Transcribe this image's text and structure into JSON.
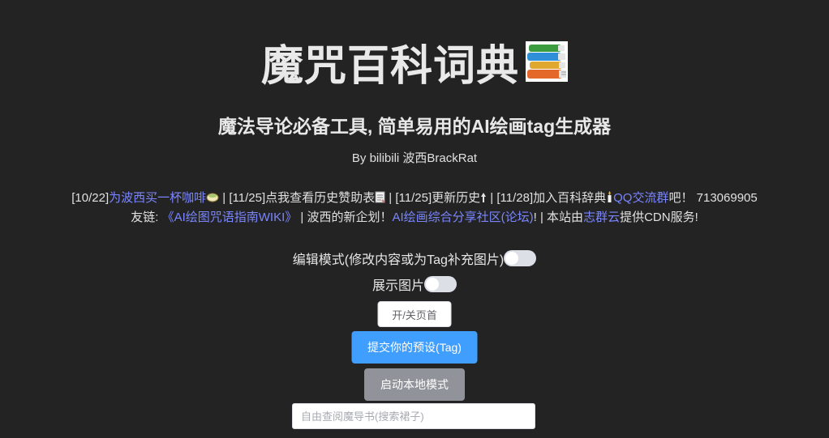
{
  "header": {
    "title": "魔咒百科词典",
    "title_icon": "books-icon",
    "subtitle": "魔法导论必备工具, 简单易用的AI绘画tag生成器",
    "byline": "By bilibili 波西BrackRat"
  },
  "notice": {
    "line1": {
      "p1": "[10/22]",
      "link_coffee": "为波西买一杯咖啡",
      "coffee_icon": "coffee-icon",
      "p2": " | [11/25]点我查看历史赞助表",
      "memo_icon": "memo-icon",
      "p3": " | [11/25]更新历史",
      "arrow_icon": "up-arrow-icon",
      "p4": " | [11/28]加入百科辞典",
      "candle_icon": "candle-icon",
      "link_qq": "QQ交流群",
      "p5": "吧！ 713069905"
    },
    "line2": {
      "p1": "友链: ",
      "link_wiki": "《AI绘图咒语指南WIKI》",
      "p2": " | 波西的新企划！",
      "link_forum": "AI绘画综合分享社区(论坛)",
      "p3": "! | 本站由",
      "link_cdn": "志群云",
      "p4": "提供CDN服务!"
    }
  },
  "controls": {
    "edit_mode_label": "编辑模式(修改内容或为Tag补充图片)",
    "edit_mode_on": false,
    "show_images_label": "展示图片",
    "show_images_on": false,
    "home_toggle_button": "开/关页首",
    "submit_button": "提交你的预设(Tag)",
    "local_mode_button": "启动本地模式",
    "search_placeholder": "自由查阅魔导书(搜索裙子)",
    "search_value": ""
  },
  "colors": {
    "background": "#232323",
    "link": "#7a86ff",
    "primary": "#409eff",
    "info": "#909399"
  }
}
